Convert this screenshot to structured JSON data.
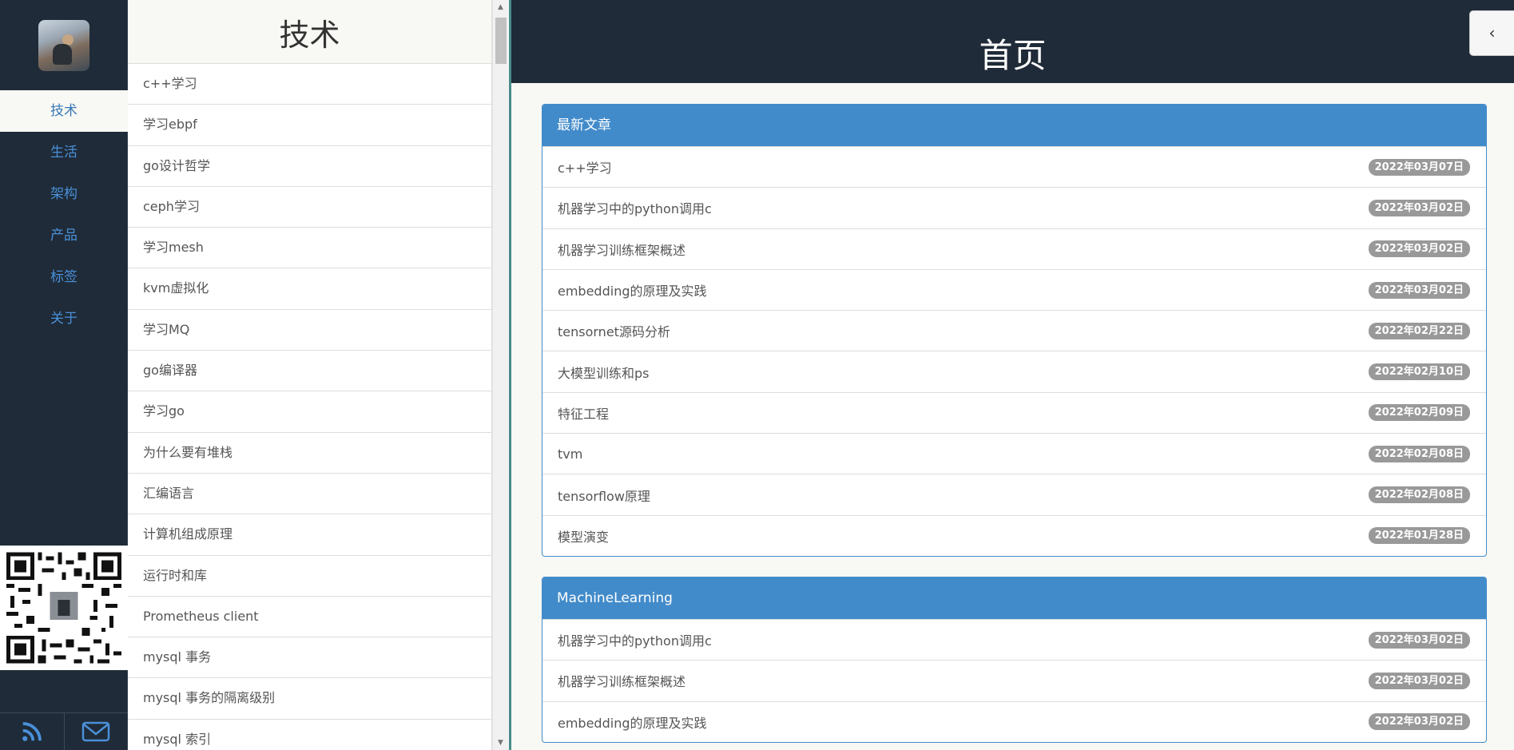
{
  "nav": {
    "items": [
      {
        "label": "技术",
        "active": true
      },
      {
        "label": "生活",
        "active": false
      },
      {
        "label": "架构",
        "active": false
      },
      {
        "label": "产品",
        "active": false
      },
      {
        "label": "标签",
        "active": false
      },
      {
        "label": "关于",
        "active": false
      }
    ],
    "icons": [
      "rss-icon",
      "mail-icon"
    ]
  },
  "list": {
    "title": "技术",
    "items": [
      "c++学习",
      "学习ebpf",
      "go设计哲学",
      "ceph学习",
      "学习mesh",
      "kvm虚拟化",
      "学习MQ",
      "go编译器",
      "学习go",
      "为什么要有堆栈",
      "汇编语言",
      "计算机组成原理",
      "运行时和库",
      "Prometheus client",
      "mysql 事务",
      "mysql 事务的隔离级别",
      "mysql 索引"
    ]
  },
  "main": {
    "title": "首页",
    "collapse_label": "‹",
    "panels": [
      {
        "title": "最新文章",
        "rows": [
          {
            "title": "c++学习",
            "date": "2022年03月07日"
          },
          {
            "title": "机器学习中的python调用c",
            "date": "2022年03月02日"
          },
          {
            "title": "机器学习训练框架概述",
            "date": "2022年03月02日"
          },
          {
            "title": "embedding的原理及实践",
            "date": "2022年03月02日"
          },
          {
            "title": "tensornet源码分析",
            "date": "2022年02月22日"
          },
          {
            "title": "大模型训练和ps",
            "date": "2022年02月10日"
          },
          {
            "title": "特征工程",
            "date": "2022年02月09日"
          },
          {
            "title": "tvm",
            "date": "2022年02月08日"
          },
          {
            "title": "tensorflow原理",
            "date": "2022年02月08日"
          },
          {
            "title": "模型演变",
            "date": "2022年01月28日"
          }
        ]
      },
      {
        "title": "MachineLearning",
        "rows": [
          {
            "title": "机器学习中的python调用c",
            "date": "2022年03月02日"
          },
          {
            "title": "机器学习训练框架概述",
            "date": "2022年03月02日"
          },
          {
            "title": "embedding的原理及实践",
            "date": "2022年03月02日"
          }
        ]
      }
    ]
  },
  "colors": {
    "sidebar": "#1f2b38",
    "accent": "#428bca",
    "badge": "#999999"
  }
}
